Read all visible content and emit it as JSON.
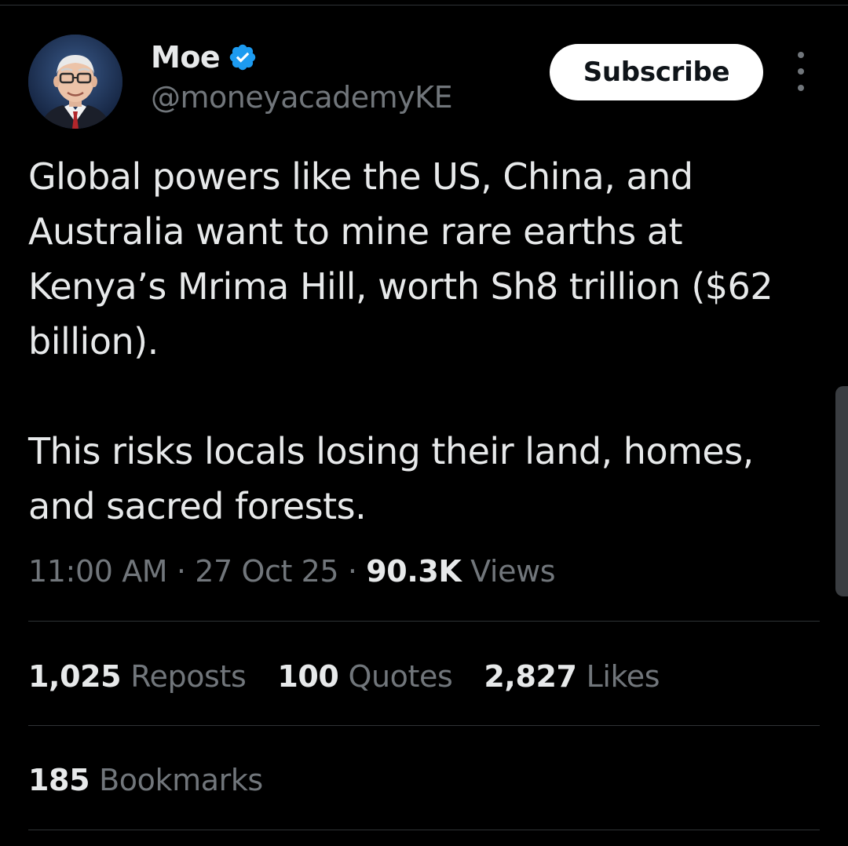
{
  "author": {
    "display_name": "Moe",
    "handle": "@moneyacademyKE",
    "verified": true,
    "verified_color": "#1d9bf0",
    "avatar_icon": "profile-photo"
  },
  "actions": {
    "subscribe_label": "Subscribe",
    "more_icon": "more-vertical-icon"
  },
  "tweet": {
    "paragraphs": [
      "Global powers like the US, China, and Australia want to mine rare earths at Kenya’s Mrima Hill, worth Sh8 trillion ($62 billion).",
      "This risks locals losing their land, homes, and sacred forests."
    ]
  },
  "meta": {
    "time": "11:00 AM",
    "separator": "·",
    "date": "27 Oct 25",
    "views_count": "90.3K",
    "views_label": "Views"
  },
  "stats": {
    "reposts_count": "1,025",
    "reposts_label": "Reposts",
    "quotes_count": "100",
    "quotes_label": "Quotes",
    "likes_count": "2,827",
    "likes_label": "Likes",
    "bookmarks_count": "185",
    "bookmarks_label": "Bookmarks"
  },
  "colors": {
    "background": "#000000",
    "text_primary": "#e7e9ea",
    "text_secondary": "#71767b",
    "divider": "#2f3336",
    "button_bg": "#ffffff",
    "button_text": "#0f1419"
  }
}
